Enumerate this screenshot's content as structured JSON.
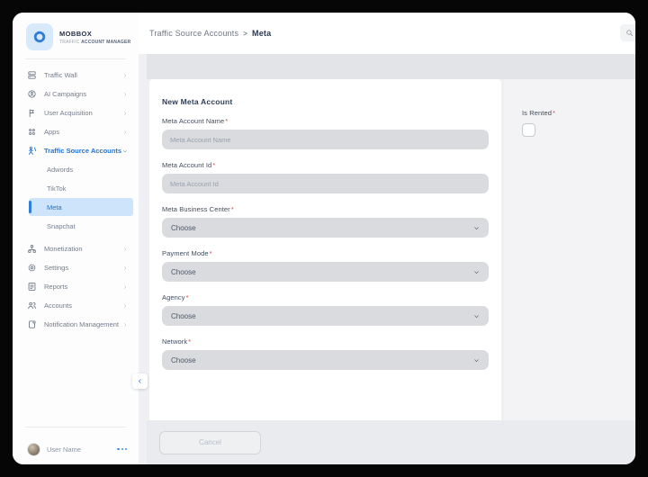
{
  "logo": {
    "title": "MOBBOX",
    "subtitle_light": "TRAFFIC",
    "subtitle_bold": "ACCOUNT MANAGER",
    "icon": "segmented-ring-icon"
  },
  "sidebar": {
    "items": [
      {
        "label": "Traffic Wall",
        "icon": "server-icon",
        "chevron": "right"
      },
      {
        "label": "AI Campaigns",
        "icon": "globe-icon",
        "chevron": "right"
      },
      {
        "label": "User Acquisition",
        "icon": "flag-icon",
        "chevron": "right"
      },
      {
        "label": "Apps",
        "icon": "grid-icon",
        "chevron": "right"
      },
      {
        "label": "Traffic Source Accounts",
        "icon": "person-road-icon",
        "chevron": "down",
        "active": true
      },
      {
        "label": "Adwords",
        "type": "sub"
      },
      {
        "label": "TikTok",
        "type": "sub"
      },
      {
        "label": "Meta",
        "type": "sub",
        "selected": true
      },
      {
        "label": "Snapchat",
        "type": "sub",
        "gap_after": true
      },
      {
        "label": "Monetization",
        "icon": "sitemap-icon",
        "chevron": "right"
      },
      {
        "label": "Settings",
        "icon": "gear-icon",
        "chevron": "right"
      },
      {
        "label": "Reports",
        "icon": "report-icon",
        "chevron": "right"
      },
      {
        "label": "Accounts",
        "icon": "users-icon",
        "chevron": "right"
      },
      {
        "label": "Notification Management",
        "icon": "notification-icon",
        "chevron": "right"
      }
    ],
    "collapse_icon": "chevron-left-icon",
    "user": {
      "name": "User Name",
      "menu_icon": "ellipsis-icon"
    }
  },
  "header": {
    "breadcrumb": [
      {
        "label": "Traffic Source Accounts"
      },
      {
        "label": "Meta",
        "current": true
      }
    ],
    "separator": ">",
    "search_icon": "search-icon"
  },
  "form": {
    "title": "New Meta Account",
    "required_marker": "*",
    "fields": [
      {
        "label": "Meta Account Name",
        "required": true,
        "type": "text",
        "placeholder": "Meta Account Name",
        "value": ""
      },
      {
        "label": "Meta Account Id",
        "required": true,
        "type": "text",
        "placeholder": "Meta Account Id",
        "value": ""
      },
      {
        "label": "Meta Business Center",
        "required": true,
        "type": "select",
        "value": "Choose"
      },
      {
        "label": "Payment Mode",
        "required": true,
        "type": "select",
        "value": "Choose"
      },
      {
        "label": "Agency",
        "required": true,
        "type": "select",
        "value": "Choose"
      },
      {
        "label": "Network",
        "required": true,
        "type": "select",
        "value": "Choose"
      }
    ],
    "side_fields": [
      {
        "label": "Is Rented",
        "required": true,
        "type": "checkbox",
        "checked": false
      }
    ],
    "cancel_label": "Cancel"
  },
  "colors": {
    "accent": "#2273d5",
    "highlight": "#cde4fa",
    "required": "#d94040"
  }
}
